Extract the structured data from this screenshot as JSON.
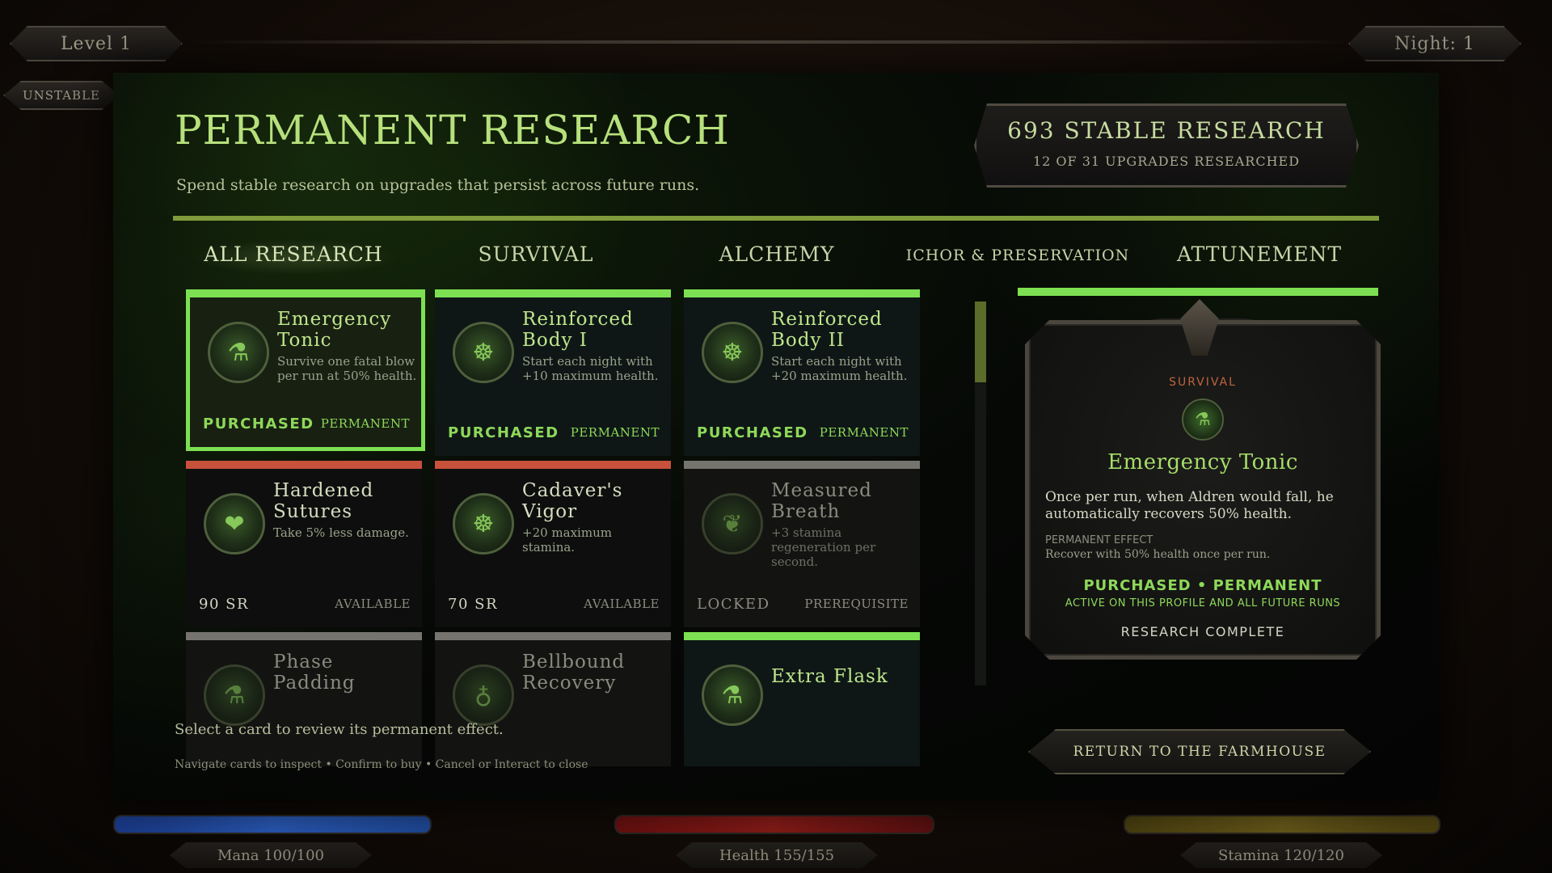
{
  "hud": {
    "level": "Level 1",
    "night": "Night: 1",
    "unstable": "UNSTABLE",
    "mana": "Mana 100/100",
    "health": "Health 155/155",
    "stamina": "Stamina 120/120"
  },
  "header": {
    "title": "PERMANENT RESEARCH",
    "subtitle": "Spend stable research on upgrades that persist across future runs.",
    "research_total": "693 STABLE RESEARCH",
    "upgrades_count": "12 OF 31 UPGRADES RESEARCHED"
  },
  "tabs": [
    {
      "label": "ALL RESEARCH"
    },
    {
      "label": "SURVIVAL"
    },
    {
      "label": "ALCHEMY"
    },
    {
      "label": "ICHOR & PRESERVATION"
    },
    {
      "label": "ATTUNEMENT"
    }
  ],
  "cards": [
    {
      "name": "Emergency Tonic",
      "desc": "Survive one fatal blow per run at 50% health.",
      "status": "PURCHASED",
      "tag": "PERMANENT",
      "icon": "flask-icon"
    },
    {
      "name": "Reinforced Body I",
      "desc": "Start each night with +10 maximum health.",
      "status": "PURCHASED",
      "tag": "PERMANENT",
      "icon": "ribcage-icon"
    },
    {
      "name": "Reinforced Body II",
      "desc": "Start each night with +20 maximum health.",
      "status": "PURCHASED",
      "tag": "PERMANENT",
      "icon": "ribcage-icon"
    },
    {
      "name": "Hardened Sutures",
      "desc": "Take 5% less damage.",
      "status": "90 SR",
      "tag": "AVAILABLE",
      "icon": "heart-icon"
    },
    {
      "name": "Cadaver's Vigor",
      "desc": "+20 maximum stamina.",
      "status": "70 SR",
      "tag": "AVAILABLE",
      "icon": "ribcage-icon"
    },
    {
      "name": "Measured Breath",
      "desc": "+3 stamina regeneration per second.",
      "status": "LOCKED",
      "tag": "PREREQUISITE",
      "icon": "lungs-icon"
    },
    {
      "name": "Phase Padding",
      "desc": "",
      "status": "",
      "tag": "",
      "icon": "flask-icon"
    },
    {
      "name": "Bellbound Recovery",
      "desc": "",
      "status": "",
      "tag": "",
      "icon": "bell-icon"
    },
    {
      "name": "Extra Flask",
      "desc": "",
      "status": "",
      "tag": "",
      "icon": "flask-icon"
    }
  ],
  "detail": {
    "category": "SURVIVAL",
    "name": "Emergency Tonic",
    "description": "Once per run, when Aldren would fall, he automatically recovers 50% health.",
    "effect_label": "PERMANENT EFFECT",
    "effect": "Recover with 50% health once per run.",
    "status": "PURCHASED • PERMANENT",
    "active": "ACTIVE ON THIS PROFILE AND ALL FUTURE RUNS",
    "complete": "RESEARCH COMPLETE"
  },
  "footer": {
    "hint": "Select a card to review its permanent effect.",
    "controls": "Navigate cards to inspect  •  Confirm to buy  •  Cancel or Interact to close",
    "return_button": "RETURN TO THE FARMHOUSE"
  },
  "colors": {
    "accent_green": "#7de052",
    "available_red": "#c8513c",
    "locked_gray": "#76746e",
    "title_green": "#b7e07c"
  }
}
